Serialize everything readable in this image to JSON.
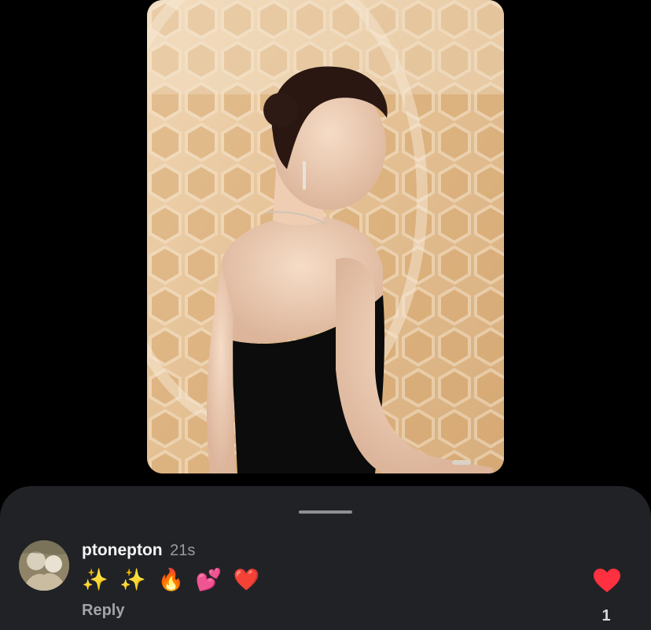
{
  "comment": {
    "username": "ptonepton",
    "time": "21s",
    "emojis": [
      "✨",
      "✨",
      "🔥",
      "💕",
      "❤️"
    ],
    "reply_label": "Reply",
    "like_count": "1"
  },
  "colors": {
    "background": "#000000",
    "sheet": "#212226",
    "like": "#ff3040"
  },
  "icons": {
    "like": "heart-icon"
  }
}
